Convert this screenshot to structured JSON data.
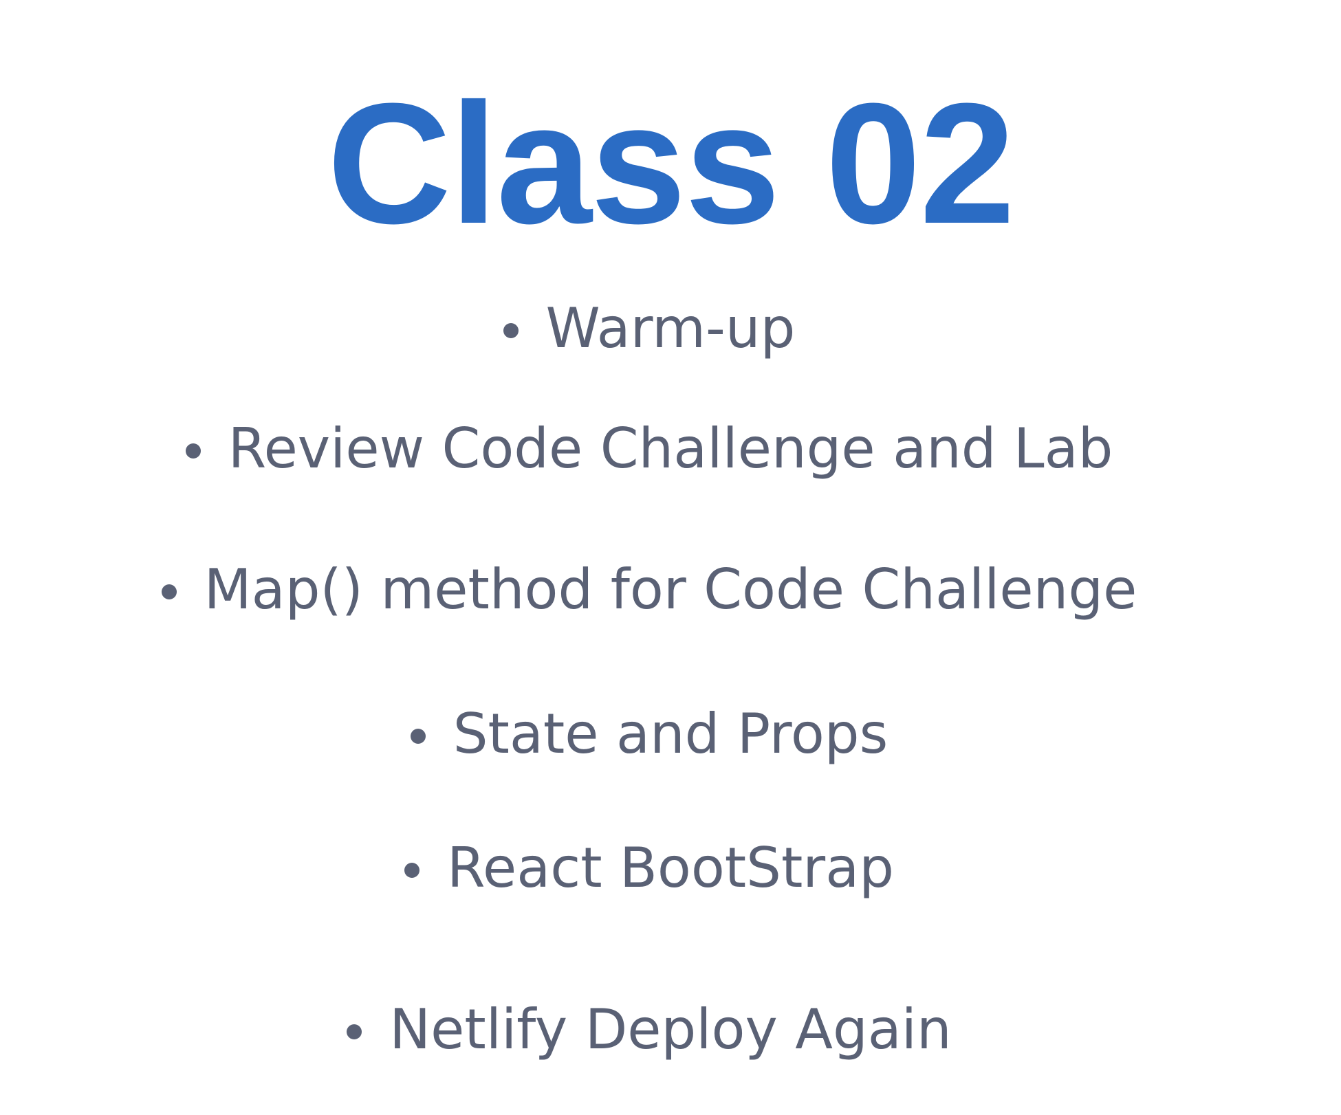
{
  "slide": {
    "title": "Class 02",
    "items": [
      {
        "label": "Warm-up"
      },
      {
        "label": "Review Code Challenge and Lab"
      },
      {
        "label": "Map() method for Code Challenge"
      },
      {
        "label": "State and Props"
      },
      {
        "label": "React BootStrap"
      },
      {
        "label": "Netlify Deploy Again"
      }
    ]
  },
  "colors": {
    "title": "#2b6cc4",
    "text": "#5a6175",
    "background": "#ffffff"
  },
  "icons": {
    "bullet": "bullet-dot-icon"
  }
}
